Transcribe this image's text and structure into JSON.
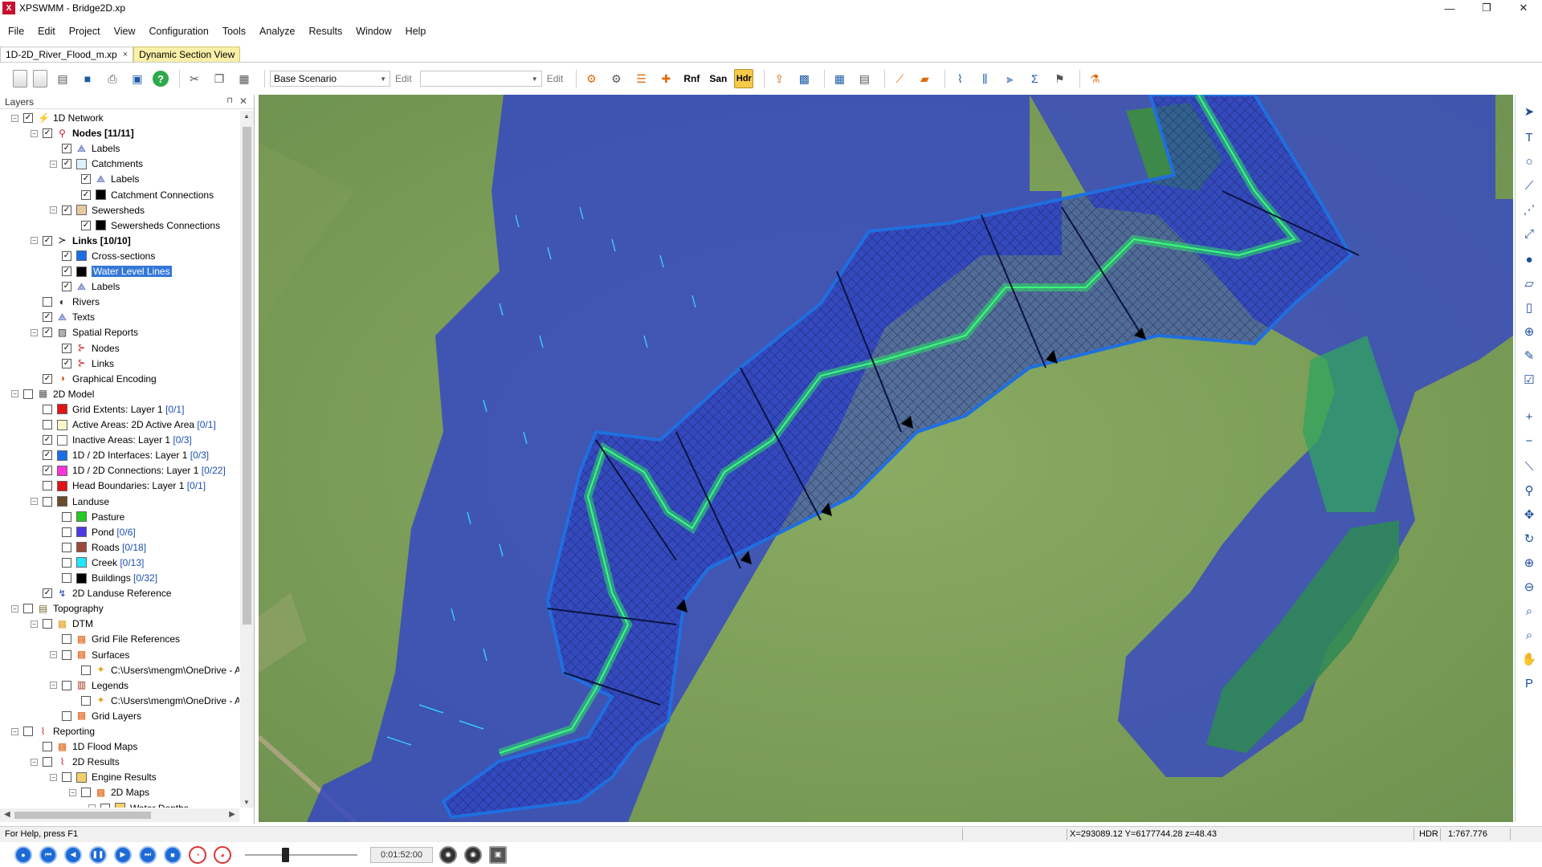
{
  "window": {
    "app_icon": "X",
    "title": "XPSWMM - Bridge2D.xp",
    "minimize": "—",
    "restore": "❐",
    "close": "✕"
  },
  "menu": [
    "File",
    "Edit",
    "Project",
    "View",
    "Configuration",
    "Tools",
    "Analyze",
    "Results",
    "Window",
    "Help"
  ],
  "doc_tabs": [
    {
      "label": "1D-2D_River_Flood_m.xp",
      "close": "×"
    },
    {
      "label": "Dynamic Section View"
    }
  ],
  "toolbar": {
    "scenario_value": "Base Scenario",
    "edit_label": "Edit",
    "combo2_value": "",
    "edit2_label": "Edit",
    "help_glyph": "?",
    "rnf": "Rnf",
    "san": "San",
    "hdr": "Hdr"
  },
  "layers_panel": {
    "title": "Layers",
    "pin_glyph": "⊓",
    "close_glyph": "✕",
    "tree": [
      {
        "level": 0,
        "exp": "-",
        "checked": true,
        "icon": "network-icon",
        "label": "1D Network",
        "bold": false
      },
      {
        "level": 1,
        "exp": "-",
        "checked": true,
        "icon": "nodes-icon",
        "label": "Nodes ",
        "count": "[11/11]",
        "bold": true
      },
      {
        "level": 2,
        "exp": "",
        "checked": true,
        "icon": "labels-icon",
        "label": "Labels"
      },
      {
        "level": 2,
        "exp": "-",
        "checked": true,
        "icon": "catchments-icon",
        "label": "Catchments"
      },
      {
        "level": 3,
        "exp": "",
        "checked": true,
        "icon": "labels-icon",
        "label": "Labels"
      },
      {
        "level": 3,
        "exp": "",
        "checked": true,
        "icon": "black-swatch-icon",
        "label": "Catchment Connections"
      },
      {
        "level": 2,
        "exp": "-",
        "checked": true,
        "icon": "sewersheds-icon",
        "label": "Sewersheds"
      },
      {
        "level": 3,
        "exp": "",
        "checked": true,
        "icon": "black-swatch-icon",
        "label": "Sewersheds Connections"
      },
      {
        "level": 1,
        "exp": "-",
        "checked": true,
        "icon": "links-icon",
        "label": "Links ",
        "count": "[10/10]",
        "bold": true
      },
      {
        "level": 2,
        "exp": "",
        "checked": true,
        "icon": "blue-swatch-icon",
        "label": "Cross-sections"
      },
      {
        "level": 2,
        "exp": "",
        "checked": true,
        "icon": "black-swatch-icon",
        "label": "Water Level Lines",
        "selected": true
      },
      {
        "level": 2,
        "exp": "",
        "checked": true,
        "icon": "labels-icon",
        "label": "Labels"
      },
      {
        "level": 1,
        "exp": "",
        "checked": false,
        "icon": "rivers-icon",
        "label": "Rivers"
      },
      {
        "level": 1,
        "exp": "",
        "checked": true,
        "icon": "labels-icon",
        "label": "Texts"
      },
      {
        "level": 1,
        "exp": "-",
        "checked": true,
        "icon": "spatial-reports-icon",
        "label": "Spatial Reports"
      },
      {
        "level": 2,
        "exp": "",
        "checked": true,
        "icon": "report-nodes-icon",
        "label": "Nodes"
      },
      {
        "level": 2,
        "exp": "",
        "checked": true,
        "icon": "report-links-icon",
        "label": "Links"
      },
      {
        "level": 1,
        "exp": "",
        "checked": true,
        "icon": "graphical-encoding-icon",
        "label": "Graphical Encoding"
      },
      {
        "level": 0,
        "exp": "-",
        "checked": false,
        "icon": "2d-model-icon",
        "label": "2D Model"
      },
      {
        "level": 1,
        "exp": "",
        "checked": false,
        "icon": "red-swatch-icon",
        "label": "Grid Extents: Layer 1 ",
        "count": "[0/1]"
      },
      {
        "level": 1,
        "exp": "",
        "checked": false,
        "icon": "yellow-swatch-icon",
        "label": "Active Areas: 2D Active Area ",
        "count": "[0/1]"
      },
      {
        "level": 1,
        "exp": "",
        "checked": true,
        "icon": "white-swatch-icon",
        "label": "Inactive Areas: Layer 1 ",
        "count": "[0/3]"
      },
      {
        "level": 1,
        "exp": "",
        "checked": true,
        "icon": "blue-swatch-icon",
        "label": "1D / 2D Interfaces: Layer 1 ",
        "count": "[0/3]"
      },
      {
        "level": 1,
        "exp": "",
        "checked": true,
        "icon": "magenta-swatch-icon",
        "label": "1D / 2D Connections: Layer 1 ",
        "count": "[0/22]"
      },
      {
        "level": 1,
        "exp": "",
        "checked": false,
        "icon": "red-swatch-icon",
        "label": "Head Boundaries: Layer 1 ",
        "count": "[0/1]"
      },
      {
        "level": 1,
        "exp": "-",
        "checked": false,
        "icon": "folder-dark-icon",
        "label": "Landuse"
      },
      {
        "level": 2,
        "exp": "",
        "checked": false,
        "icon": "green-swatch-icon",
        "label": "Pasture"
      },
      {
        "level": 2,
        "exp": "",
        "checked": false,
        "icon": "purple-swatch-icon",
        "label": "Pond ",
        "count": "[0/6]"
      },
      {
        "level": 2,
        "exp": "",
        "checked": false,
        "icon": "brown-swatch-icon",
        "label": "Roads ",
        "count": "[0/18]"
      },
      {
        "level": 2,
        "exp": "",
        "checked": false,
        "icon": "cyan-swatch-icon",
        "label": "Creek ",
        "count": "[0/13]"
      },
      {
        "level": 2,
        "exp": "",
        "checked": false,
        "icon": "black-swatch-icon",
        "label": "Buildings ",
        "count": "[0/32]"
      },
      {
        "level": 1,
        "exp": "",
        "checked": true,
        "icon": "landuse-reference-icon",
        "label": "2D Landuse Reference"
      },
      {
        "level": 0,
        "exp": "-",
        "checked": false,
        "icon": "topography-icon",
        "label": "Topography"
      },
      {
        "level": 1,
        "exp": "-",
        "checked": false,
        "icon": "dtm-icon",
        "label": "DTM"
      },
      {
        "level": 2,
        "exp": "",
        "checked": false,
        "icon": "grid-file-icon",
        "label": "Grid File References"
      },
      {
        "level": 2,
        "exp": "-",
        "checked": false,
        "icon": "surfaces-icon",
        "label": "Surfaces"
      },
      {
        "level": 3,
        "exp": "",
        "checked": false,
        "icon": "star-icon",
        "label": "C:\\Users\\mengm\\OneDrive - A"
      },
      {
        "level": 2,
        "exp": "-",
        "checked": false,
        "icon": "legends-icon",
        "label": "Legends"
      },
      {
        "level": 3,
        "exp": "",
        "checked": false,
        "icon": "star-icon",
        "label": "C:\\Users\\mengm\\OneDrive - A"
      },
      {
        "level": 2,
        "exp": "",
        "checked": false,
        "icon": "grid-layers-icon",
        "label": "Grid Layers"
      },
      {
        "level": 0,
        "exp": "-",
        "checked": false,
        "icon": "reporting-icon",
        "label": "Reporting"
      },
      {
        "level": 1,
        "exp": "",
        "checked": false,
        "icon": "flood-maps-icon",
        "label": "1D Flood Maps"
      },
      {
        "level": 1,
        "exp": "-",
        "checked": false,
        "icon": "2d-results-icon",
        "label": "2D Results"
      },
      {
        "level": 2,
        "exp": "-",
        "checked": false,
        "icon": "folder-icon",
        "label": "Engine Results"
      },
      {
        "level": 3,
        "exp": "-",
        "checked": false,
        "icon": "2d-maps-icon",
        "label": "2D Maps"
      },
      {
        "level": 4,
        "exp": "-",
        "checked": false,
        "icon": "folder-icon",
        "label": "Water Depths"
      }
    ]
  },
  "status": {
    "help": "For Help, press F1",
    "coords": "X=293089.12   Y=6177744.28   z=48.43",
    "hdr": "HDR",
    "scale": "1:767.776"
  },
  "playback": {
    "time": "0:01:52:00",
    "progress": 0.35
  },
  "colors": {
    "grass": "#7fa05a",
    "flood_shallow": "#3a48c8",
    "channel_outline": "#1f6fe0",
    "hdr_yellow": "#f7c948"
  }
}
